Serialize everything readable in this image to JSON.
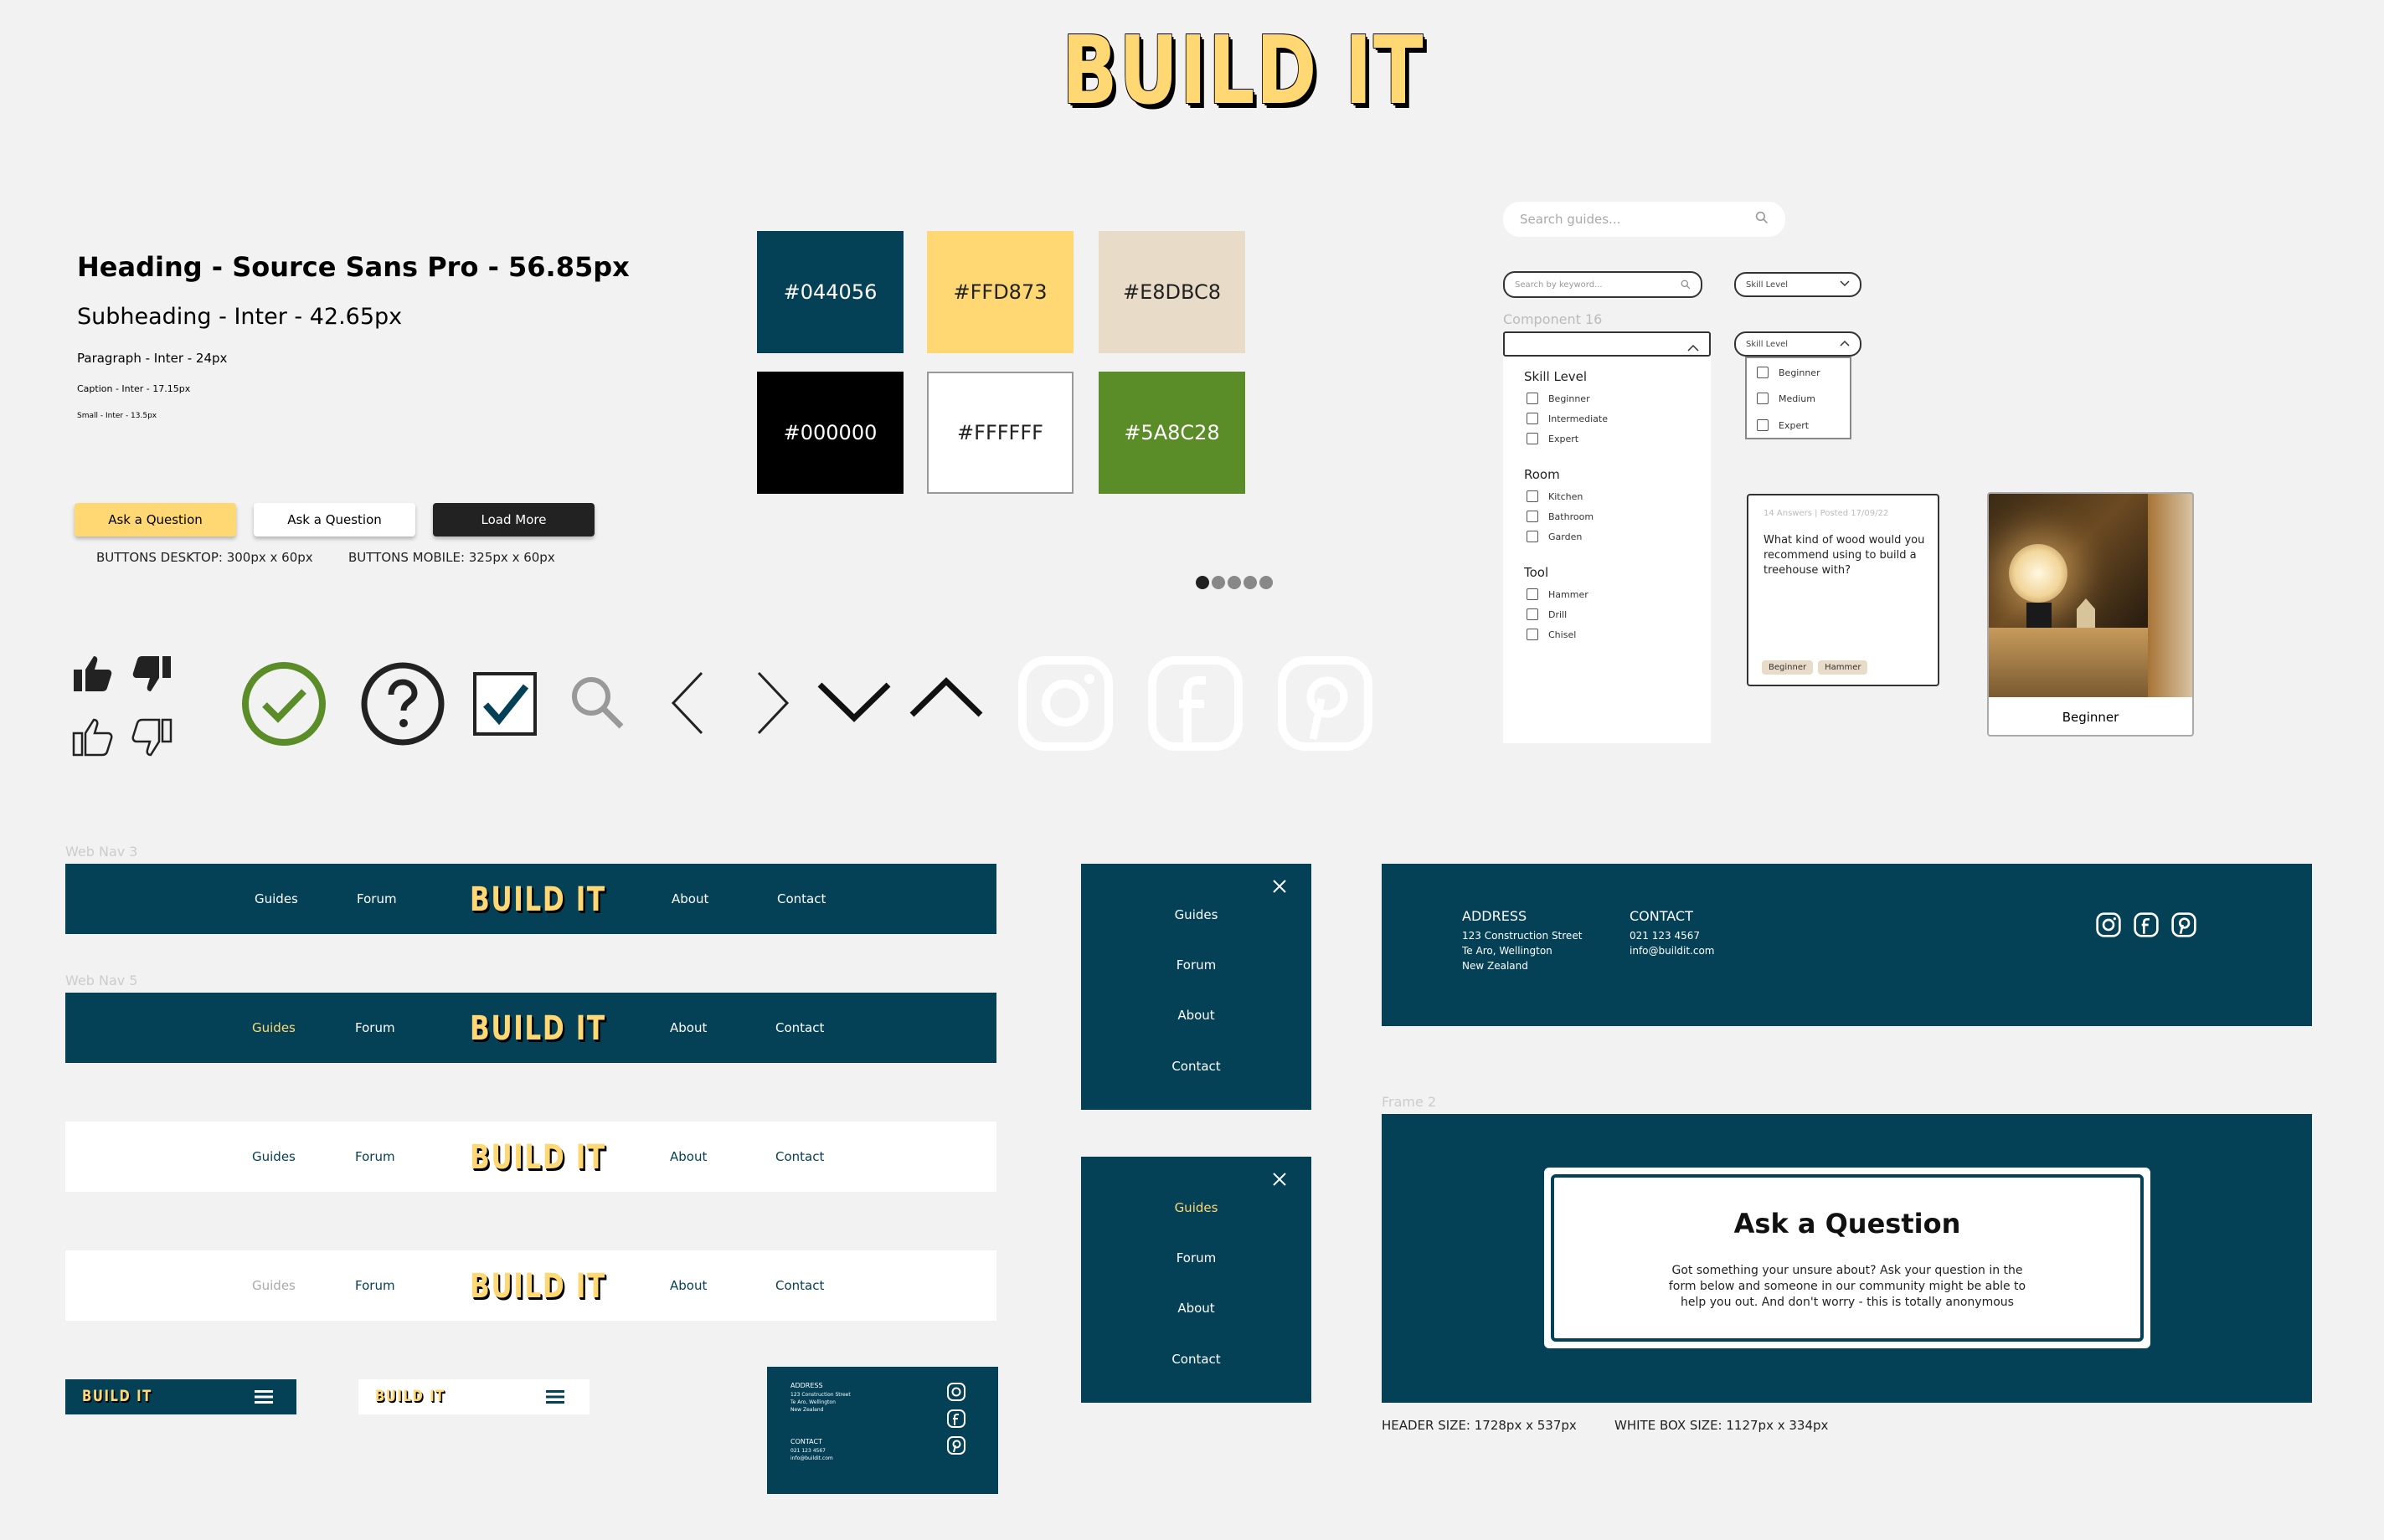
{
  "logo": {
    "text": "BUILD IT"
  },
  "typography": {
    "heading": "Heading - Source Sans Pro -  56.85px",
    "subheading": "Subheading - Inter - 42.65px",
    "paragraph": "Paragraph - Inter - 24px",
    "caption": "Caption - Inter - 17.15px",
    "small": "Small - Inter - 13.5px"
  },
  "buttons": {
    "primary": "Ask a Question",
    "secondary": "Ask a Question",
    "dark": "Load More",
    "desktop_caption": "BUTTONS DESKTOP: 300px x 60px",
    "mobile_caption": "BUTTONS MOBILE: 325px x 60px"
  },
  "colors": {
    "swatches": [
      {
        "hex": "#044056"
      },
      {
        "hex": "#FFD873"
      },
      {
        "hex": "#E8DBC8"
      },
      {
        "hex": "#000000"
      },
      {
        "hex": "#FFFFFF"
      },
      {
        "hex": "#5A8C28"
      }
    ],
    "accent_green": "#5A8C28",
    "navy": "#044056",
    "yellow": "#FFD873",
    "beige": "#E8DBC8"
  },
  "search": {
    "main_placeholder": "Search guides...",
    "keyword_placeholder": "Search by keyword...",
    "skill_level_label": "Skill Level",
    "skill_level_label_open": "Skill Level",
    "component_label": "Component 16"
  },
  "skill_dropdown": {
    "options": [
      "Beginner",
      "Medium",
      "Expert"
    ]
  },
  "filters": {
    "groups": [
      {
        "title": "Skill Level",
        "items": [
          "Beginner",
          "Intermediate",
          "Expert"
        ]
      },
      {
        "title": "Room",
        "items": [
          "Kitchen",
          "Bathroom",
          "Garden"
        ]
      },
      {
        "title": "Tool",
        "items": [
          "Hammer",
          "Drill",
          "Chisel"
        ]
      }
    ]
  },
  "question_card": {
    "meta": "14 Answers | Posted 17/09/22",
    "question": "What kind of wood would you recommend using to build a treehouse with?",
    "tags": [
      "Beginner",
      "Hammer"
    ]
  },
  "guide_card": {
    "label": "Beginner"
  },
  "icons": [
    "thumbs-up-filled-icon",
    "thumbs-down-filled-icon",
    "thumbs-up-outline-icon",
    "thumbs-down-outline-icon",
    "check-circle-icon",
    "question-circle-icon",
    "checkbox-checked-icon",
    "search-icon",
    "chevron-left-icon",
    "chevron-right-icon",
    "chevron-down-icon",
    "chevron-up-icon",
    "instagram-icon",
    "facebook-icon",
    "pinterest-icon"
  ],
  "navs": {
    "label_3": "Web Nav 3",
    "label_5": "Web Nav 5",
    "items": {
      "guides": "Guides",
      "forum": "Forum",
      "about": "About",
      "contact": "Contact"
    }
  },
  "mobile_menu": {
    "items": [
      "Guides",
      "Forum",
      "About",
      "Contact"
    ]
  },
  "footer": {
    "address_title": "ADDRESS",
    "address_lines": [
      "123 Construction Street",
      "Te Aro, Wellington",
      "New Zealand"
    ],
    "contact_title": "CONTACT",
    "contact_lines": [
      "021 123 4567",
      "info@buildit.com"
    ]
  },
  "header_frame": {
    "label": "Frame 2",
    "title": "Ask a Question",
    "body": "Got something your unsure about? Ask your question in the form below and someone in our community might be able to help you out. And don't worry - this is totally anonymous",
    "header_size_caption": "HEADER SIZE: 1728px x 537px",
    "white_box_caption": "WHITE BOX SIZE: 1127px x 334px"
  }
}
